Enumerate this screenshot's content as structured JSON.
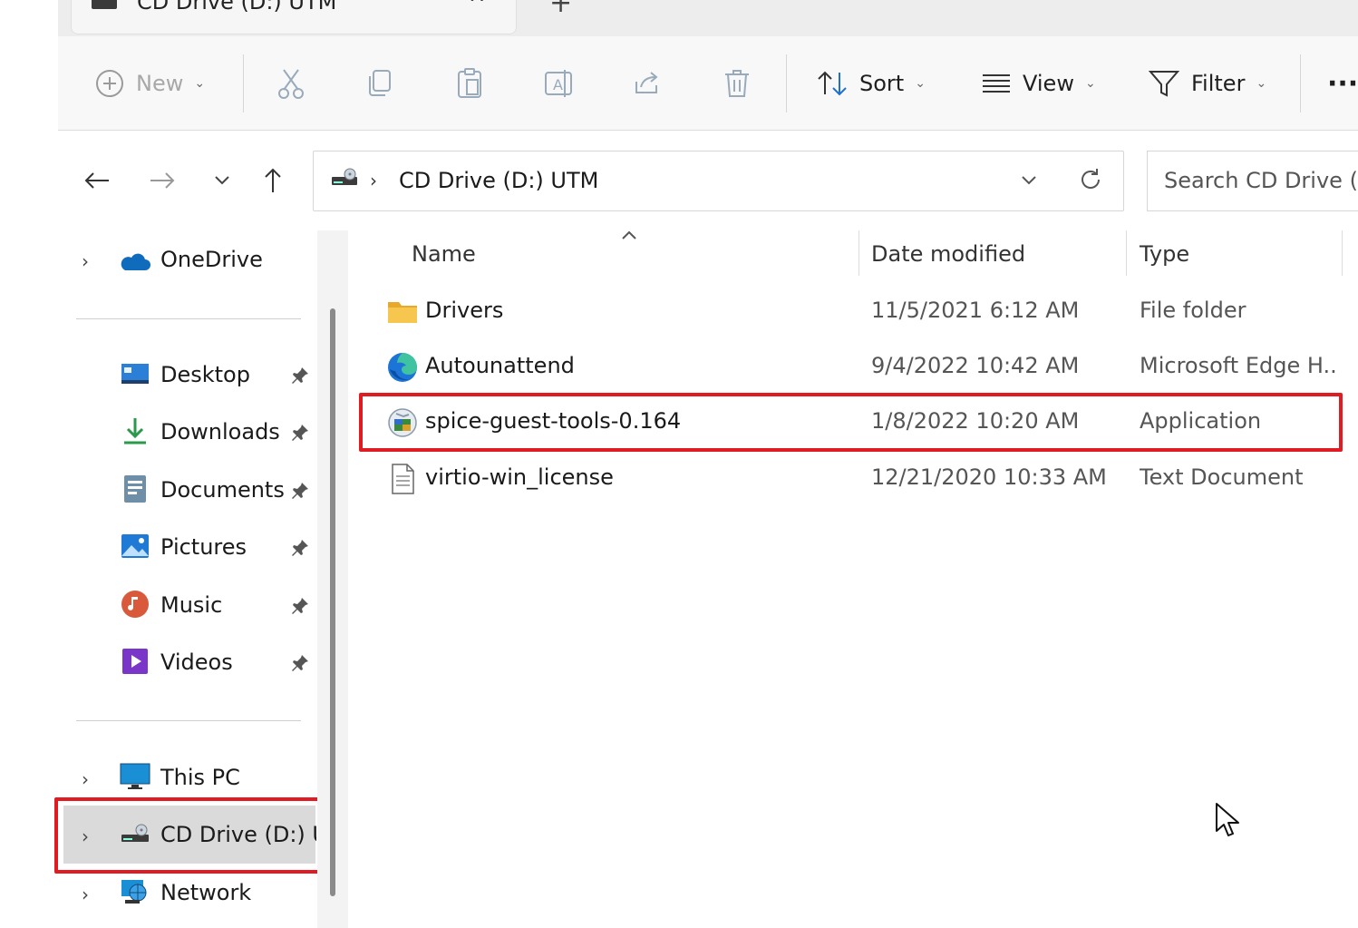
{
  "tab": {
    "title": "CD Drive (D:) UTM",
    "close_glyph": "^",
    "new_tab_glyph": "+"
  },
  "toolbar": {
    "new_label": "New",
    "sort_label": "Sort",
    "view_label": "View",
    "filter_label": "Filter",
    "more_label": "···",
    "icons": [
      "cut-icon",
      "copy-icon",
      "paste-icon",
      "rename-icon",
      "share-icon",
      "delete-icon"
    ]
  },
  "address": {
    "separator": "›",
    "path": "CD Drive (D:) UTM",
    "search_placeholder": "Search CD Drive (D:)"
  },
  "sidebar": {
    "items": [
      {
        "id": "onedrive",
        "label": "OneDrive",
        "icon": "cloud-icon",
        "expandable": true
      },
      {
        "id": "desktop",
        "label": "Desktop",
        "icon": "desktop-icon",
        "pinned": true
      },
      {
        "id": "downloads",
        "label": "Downloads",
        "icon": "download-icon",
        "pinned": true
      },
      {
        "id": "documents",
        "label": "Documents",
        "icon": "documents-icon",
        "pinned": true
      },
      {
        "id": "pictures",
        "label": "Pictures",
        "icon": "pictures-icon",
        "pinned": true
      },
      {
        "id": "music",
        "label": "Music",
        "icon": "music-icon",
        "pinned": true
      },
      {
        "id": "videos",
        "label": "Videos",
        "icon": "videos-icon",
        "pinned": true
      },
      {
        "id": "thispc",
        "label": "This PC",
        "icon": "computer-icon",
        "expandable": true
      },
      {
        "id": "cddrive",
        "label": "CD Drive (D:) UTM",
        "icon": "cd-drive-icon",
        "expandable": true,
        "selected": true
      },
      {
        "id": "network",
        "label": "Network",
        "icon": "network-icon",
        "expandable": true
      }
    ],
    "expand_glyph": "›"
  },
  "columns": {
    "name": "Name",
    "date": "Date modified",
    "type": "Type"
  },
  "files": [
    {
      "name": "Drivers",
      "date": "11/5/2021 6:12 AM",
      "type": "File folder",
      "icon": "folder-icon"
    },
    {
      "name": "Autounattend",
      "date": "9/4/2022 10:42 AM",
      "type": "Microsoft Edge H...",
      "icon": "edge-icon"
    },
    {
      "name": "spice-guest-tools-0.164",
      "date": "1/8/2022 10:20 AM",
      "type": "Application",
      "icon": "installer-icon",
      "highlighted": true
    },
    {
      "name": "virtio-win_license",
      "date": "12/21/2020 10:33 AM",
      "type": "Text Document",
      "icon": "text-file-icon"
    }
  ],
  "colors": {
    "highlight": "#e11b22",
    "folder": "#f2c04b",
    "selected_bg": "#dadada"
  }
}
